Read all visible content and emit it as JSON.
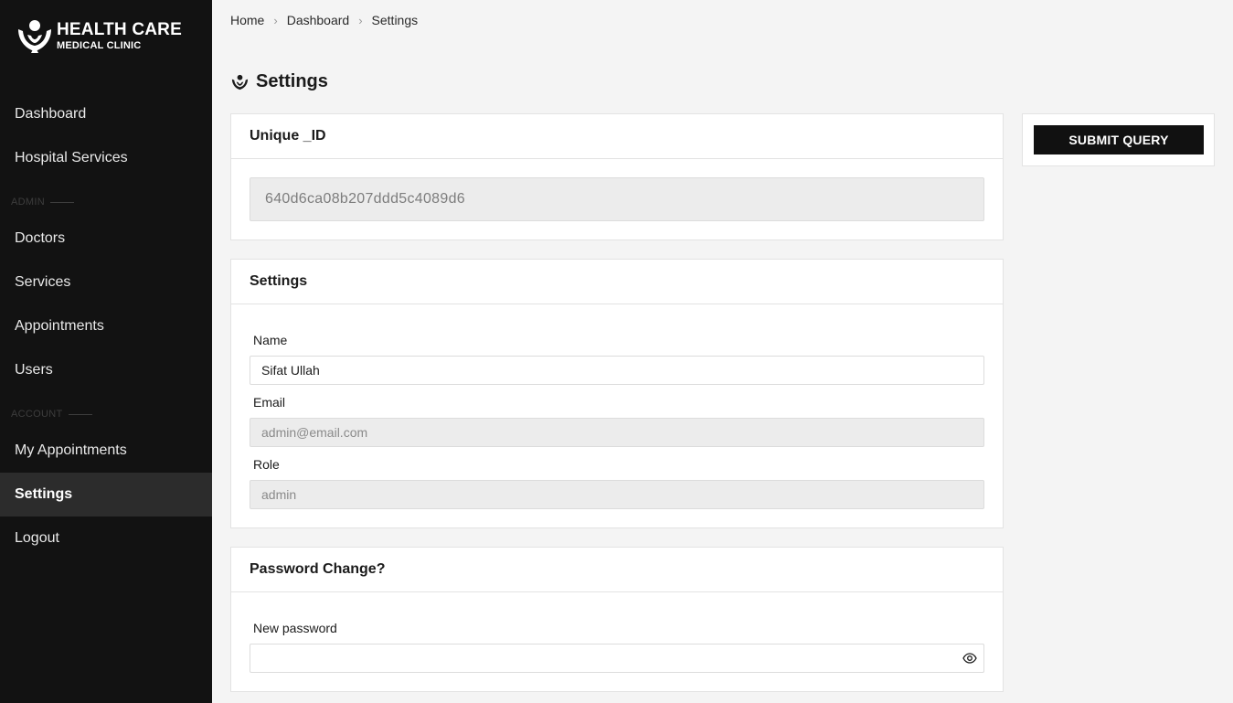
{
  "brand": {
    "title": "HEALTH CARE",
    "subtitle": "MEDICAL CLINIC"
  },
  "sidebar": {
    "items_top": [
      {
        "label": "Dashboard"
      },
      {
        "label": "Hospital Services"
      }
    ],
    "section_admin": "ADMIN",
    "items_admin": [
      {
        "label": "Doctors"
      },
      {
        "label": "Services"
      },
      {
        "label": "Appointments"
      },
      {
        "label": "Users"
      }
    ],
    "section_account": "ACCOUNT",
    "items_account": [
      {
        "label": "My Appointments"
      },
      {
        "label": "Settings",
        "active": true
      },
      {
        "label": "Logout"
      }
    ]
  },
  "breadcrumb": [
    "Home",
    "Dashboard",
    "Settings"
  ],
  "page_title": "Settings",
  "unique_id_card": {
    "header": "Unique _ID",
    "value": "640d6ca08b207ddd5c4089d6"
  },
  "settings_card": {
    "header": "Settings",
    "name_label": "Name",
    "name_value": "Sifat Ullah",
    "email_label": "Email",
    "email_value": "admin@email.com",
    "role_label": "Role",
    "role_value": "admin"
  },
  "password_card": {
    "header": "Password Change?",
    "new_password_label": "New password",
    "new_password_value": ""
  },
  "submit_label": "SUBMIT QUERY",
  "colors": {
    "sidebar_bg": "#121212",
    "active_item_bg": "#2c2c2c",
    "button_bg": "#111111",
    "page_bg": "#f4f4f4"
  },
  "icons": {
    "logo": "caring-hands-heart-icon",
    "eye": "eye-icon",
    "chevron": "chevron-right-icon"
  }
}
